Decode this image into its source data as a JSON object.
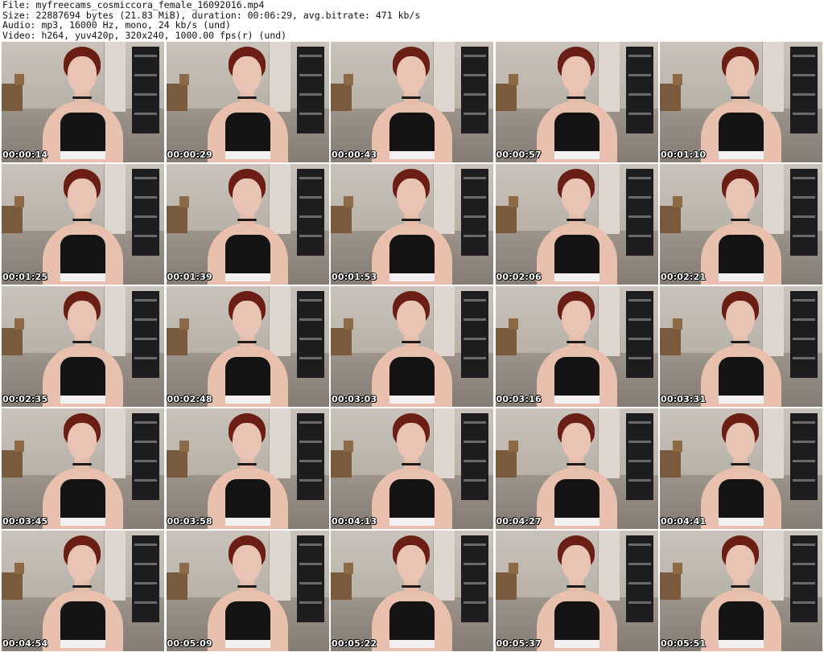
{
  "header": {
    "file_line": "File: myfreecams_cosmiccora_female_16092016.mp4",
    "size_line": "Size: 22887694 bytes (21.83 MiB), duration: 00:06:29, avg.bitrate: 471 kb/s",
    "audio_line": "Audio: mp3, 16000 Hz, mono, 24 kb/s (und)",
    "video_line": "Video: h264, yuv420p, 320x240, 1000.00 fps(r) (und)"
  },
  "thumbnails": [
    {
      "timestamp": "00:00:14"
    },
    {
      "timestamp": "00:00:29"
    },
    {
      "timestamp": "00:00:43"
    },
    {
      "timestamp": "00:00:57"
    },
    {
      "timestamp": "00:01:10"
    },
    {
      "timestamp": "00:01:25"
    },
    {
      "timestamp": "00:01:39"
    },
    {
      "timestamp": "00:01:53"
    },
    {
      "timestamp": "00:02:06"
    },
    {
      "timestamp": "00:02:21"
    },
    {
      "timestamp": "00:02:35"
    },
    {
      "timestamp": "00:02:48"
    },
    {
      "timestamp": "00:03:03"
    },
    {
      "timestamp": "00:03:16"
    },
    {
      "timestamp": "00:03:31"
    },
    {
      "timestamp": "00:03:45"
    },
    {
      "timestamp": "00:03:58"
    },
    {
      "timestamp": "00:04:13"
    },
    {
      "timestamp": "00:04:27"
    },
    {
      "timestamp": "00:04:41"
    },
    {
      "timestamp": "00:04:54"
    },
    {
      "timestamp": "00:05:09"
    },
    {
      "timestamp": "00:05:22"
    },
    {
      "timestamp": "00:05:37"
    },
    {
      "timestamp": "00:05:51"
    }
  ]
}
